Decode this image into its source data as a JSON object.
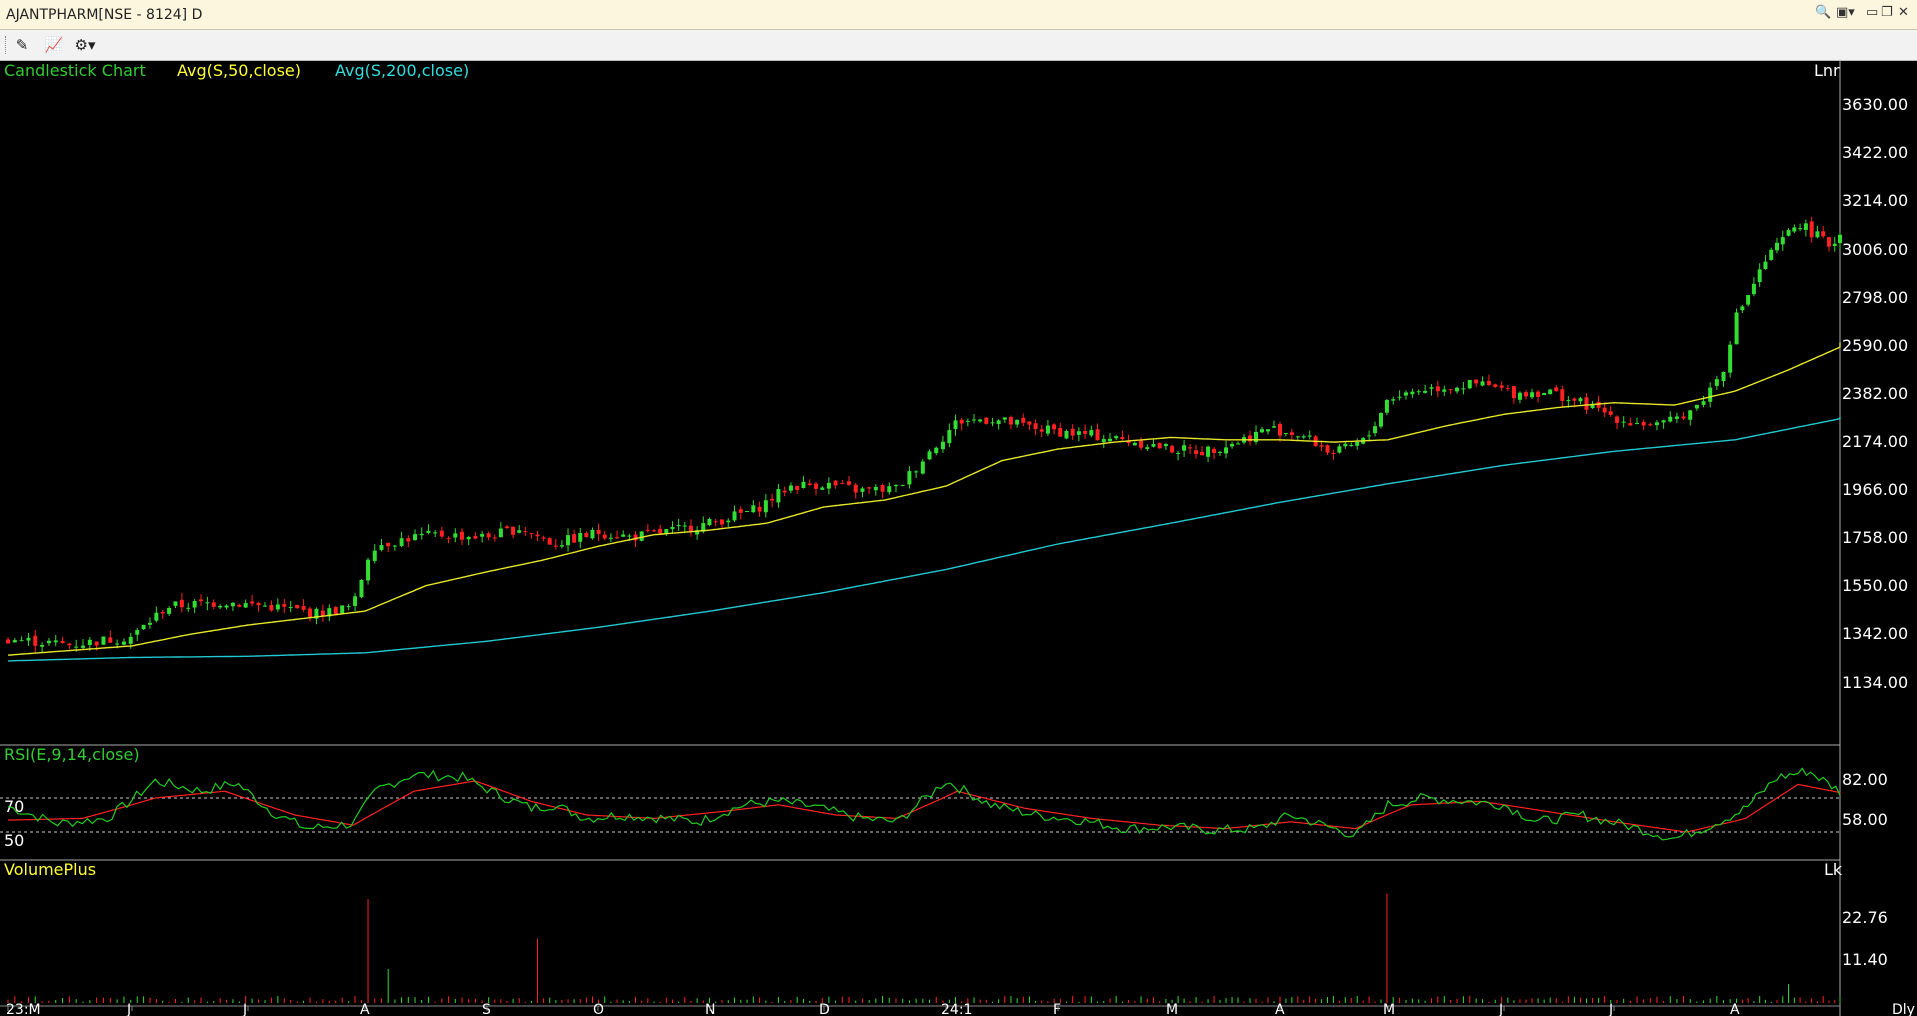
{
  "window": {
    "title": "AJANTPHARM[NSE - 8124] D",
    "controls": [
      "search-icon",
      "user-icon",
      "minimize-icon",
      "restore-icon",
      "close-icon"
    ]
  },
  "toolbar": {
    "buttons": [
      "crosshair-icon",
      "chart-type-icon",
      "settings-gear-icon"
    ]
  },
  "colors": {
    "up": "#33dd33",
    "down": "#ff2222",
    "ma50": "#e6e62a",
    "ma200": "#22c8d0",
    "rsi": "#22cc22",
    "rsi_signal": "#ff2222",
    "label_green": "#33cc33",
    "label_yellow": "#ffff33",
    "label_cyan": "#33dddd"
  },
  "price_panel": {
    "chart_label": "Candlestick Chart",
    "ma1_label": "Avg(S,50,close)",
    "ma2_label": "Avg(S,200,close)",
    "scale_label": "Lnr",
    "y_ticks": [
      "3630.00",
      "3422.00",
      "3214.00",
      "3006.00",
      "2798.00",
      "2590.00",
      "2382.00",
      "2174.00",
      "1966.00",
      "1758.00",
      "1550.00",
      "1342.00",
      "1134.00"
    ]
  },
  "rsi_panel": {
    "label": "RSI(E,9,14,close)",
    "level_high": "70",
    "level_low": "50",
    "y_ticks": [
      "82.00",
      "58.00"
    ]
  },
  "volume_panel": {
    "label": "VolumePlus",
    "unit": "Lk",
    "y_ticks": [
      "22.76",
      "11.40"
    ]
  },
  "x_axis": {
    "labels": [
      "23:M",
      "J",
      "J",
      "A",
      "S",
      "O",
      "N",
      "D",
      "24:1",
      "F",
      "M",
      "A",
      "M",
      "J",
      "J",
      "A"
    ],
    "corner": "Dly"
  },
  "chart_data": {
    "type": "candlestick",
    "months": [
      "23:M",
      "J",
      "J",
      "A",
      "S",
      "O",
      "N",
      "D",
      "24:1",
      "F",
      "M",
      "A",
      "M",
      "J",
      "J",
      "A"
    ],
    "close_path": [
      [
        0,
        1320
      ],
      [
        0.5,
        1295
      ],
      [
        1,
        1330
      ],
      [
        1.3,
        1460
      ],
      [
        1.8,
        1480
      ],
      [
        2.2,
        1460
      ],
      [
        2.6,
        1430
      ],
      [
        2.9,
        1460
      ],
      [
        3.05,
        1720
      ],
      [
        3.4,
        1760
      ],
      [
        3.6,
        1770
      ],
      [
        4,
        1760
      ],
      [
        4.3,
        1800
      ],
      [
        4.6,
        1730
      ],
      [
        5,
        1780
      ],
      [
        5.3,
        1760
      ],
      [
        5.7,
        1790
      ],
      [
        6,
        1820
      ],
      [
        6.4,
        1880
      ],
      [
        6.7,
        1980
      ],
      [
        7,
        1990
      ],
      [
        7.3,
        1960
      ],
      [
        7.6,
        1970
      ],
      [
        7.9,
        2150
      ],
      [
        8.1,
        2260
      ],
      [
        8.4,
        2270
      ],
      [
        8.8,
        2230
      ],
      [
        9.1,
        2210
      ],
      [
        9.3,
        2200
      ],
      [
        9.7,
        2170
      ],
      [
        10,
        2140
      ],
      [
        10.3,
        2130
      ],
      [
        10.6,
        2170
      ],
      [
        10.9,
        2230
      ],
      [
        11.2,
        2200
      ],
      [
        11.5,
        2120
      ],
      [
        11.8,
        2180
      ],
      [
        12.0,
        2360
      ],
      [
        12.3,
        2400
      ],
      [
        12.8,
        2420
      ],
      [
        13.1,
        2380
      ],
      [
        13.4,
        2390
      ],
      [
        13.8,
        2320
      ],
      [
        14.1,
        2260
      ],
      [
        14.4,
        2240
      ],
      [
        14.7,
        2330
      ],
      [
        14.9,
        2480
      ],
      [
        15.0,
        2700
      ],
      [
        15.3,
        2960
      ],
      [
        15.6,
        3120
      ],
      [
        15.9,
        3020
      ],
      [
        16.1,
        3100
      ]
    ],
    "ma50_path": [
      [
        0,
        1250
      ],
      [
        0.5,
        1270
      ],
      [
        1,
        1290
      ],
      [
        1.5,
        1340
      ],
      [
        2,
        1380
      ],
      [
        2.5,
        1410
      ],
      [
        3,
        1440
      ],
      [
        3.5,
        1550
      ],
      [
        4,
        1610
      ],
      [
        4.5,
        1660
      ],
      [
        5,
        1720
      ],
      [
        5.5,
        1770
      ],
      [
        6,
        1790
      ],
      [
        6.5,
        1820
      ],
      [
        7,
        1890
      ],
      [
        7.5,
        1920
      ],
      [
        8,
        1980
      ],
      [
        8.5,
        2090
      ],
      [
        9,
        2140
      ],
      [
        9.5,
        2170
      ],
      [
        10,
        2190
      ],
      [
        10.5,
        2180
      ],
      [
        11,
        2180
      ],
      [
        11.5,
        2170
      ],
      [
        12,
        2180
      ],
      [
        12.5,
        2240
      ],
      [
        13,
        2290
      ],
      [
        13.5,
        2320
      ],
      [
        14,
        2340
      ],
      [
        14.5,
        2330
      ],
      [
        15,
        2390
      ],
      [
        15.5,
        2480
      ],
      [
        16.1,
        2600
      ]
    ],
    "ma200_path": [
      [
        0,
        1225
      ],
      [
        1,
        1240
      ],
      [
        2,
        1245
      ],
      [
        3,
        1260
      ],
      [
        4,
        1310
      ],
      [
        5,
        1370
      ],
      [
        6,
        1440
      ],
      [
        7,
        1520
      ],
      [
        8,
        1620
      ],
      [
        9,
        1730
      ],
      [
        10,
        1820
      ],
      [
        11,
        1910
      ],
      [
        12,
        1990
      ],
      [
        13,
        2070
      ],
      [
        14,
        2130
      ],
      [
        15,
        2180
      ],
      [
        16.1,
        2280
      ]
    ],
    "rsi_path": [
      [
        0,
        65
      ],
      [
        0.4,
        55
      ],
      [
        0.8,
        58
      ],
      [
        1.2,
        80
      ],
      [
        1.6,
        74
      ],
      [
        1.9,
        79
      ],
      [
        2.2,
        62
      ],
      [
        2.5,
        52
      ],
      [
        2.9,
        55
      ],
      [
        3.1,
        75
      ],
      [
        3.4,
        84
      ],
      [
        3.8,
        82
      ],
      [
        4.1,
        72
      ],
      [
        4.4,
        64
      ],
      [
        4.6,
        66
      ],
      [
        4.9,
        58
      ],
      [
        5.2,
        60
      ],
      [
        5.6,
        58
      ],
      [
        5.9,
        56
      ],
      [
        6.3,
        66
      ],
      [
        6.6,
        68
      ],
      [
        6.9,
        65
      ],
      [
        7.3,
        58
      ],
      [
        7.6,
        56
      ],
      [
        8.0,
        80
      ],
      [
        8.4,
        66
      ],
      [
        8.8,
        60
      ],
      [
        9.2,
        57
      ],
      [
        9.6,
        52
      ],
      [
        10,
        53
      ],
      [
        10.4,
        51
      ],
      [
        10.8,
        52
      ],
      [
        11.1,
        60
      ],
      [
        11.4,
        54
      ],
      [
        11.7,
        48
      ],
      [
        12,
        66
      ],
      [
        12.3,
        70
      ],
      [
        12.7,
        68
      ],
      [
        13.0,
        66
      ],
      [
        13.3,
        56
      ],
      [
        13.7,
        60
      ],
      [
        14.1,
        54
      ],
      [
        14.5,
        46
      ],
      [
        14.8,
        54
      ],
      [
        15.1,
        64
      ],
      [
        15.4,
        82
      ],
      [
        15.7,
        86
      ],
      [
        15.9,
        78
      ],
      [
        16.1,
        70
      ]
    ],
    "rsi_signal_path": [
      [
        0,
        57
      ],
      [
        0.6,
        58
      ],
      [
        1.2,
        70
      ],
      [
        1.8,
        74
      ],
      [
        2.4,
        60
      ],
      [
        2.9,
        54
      ],
      [
        3.4,
        74
      ],
      [
        3.9,
        80
      ],
      [
        4.4,
        68
      ],
      [
        4.9,
        60
      ],
      [
        5.5,
        58
      ],
      [
        6.1,
        62
      ],
      [
        6.6,
        66
      ],
      [
        7.1,
        60
      ],
      [
        7.6,
        58
      ],
      [
        8.1,
        74
      ],
      [
        8.7,
        64
      ],
      [
        9.3,
        58
      ],
      [
        9.9,
        54
      ],
      [
        10.5,
        52
      ],
      [
        11.1,
        56
      ],
      [
        11.7,
        52
      ],
      [
        12.2,
        66
      ],
      [
        12.8,
        68
      ],
      [
        13.4,
        62
      ],
      [
        14.0,
        56
      ],
      [
        14.6,
        50
      ],
      [
        15.1,
        58
      ],
      [
        15.6,
        78
      ],
      [
        16.1,
        72
      ]
    ],
    "volume_spikes": [
      [
        3.05,
        27.5
      ],
      [
        3.2,
        9
      ],
      [
        4.45,
        17
      ],
      [
        12.0,
        29
      ],
      [
        15.5,
        5
      ]
    ],
    "rsi_levels": [
      70,
      50
    ]
  }
}
